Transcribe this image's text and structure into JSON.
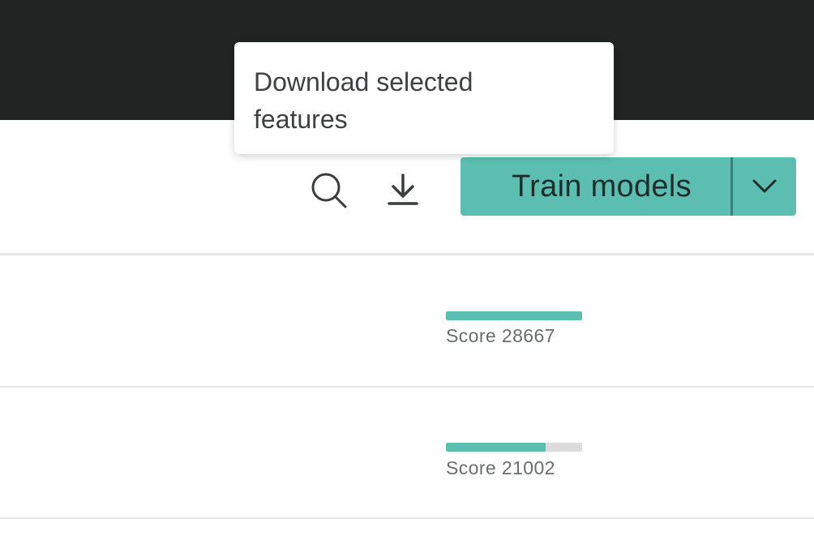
{
  "tooltip": {
    "text_line1": "Download selected",
    "text_line2": "features"
  },
  "toolbar": {
    "search_icon": "search-icon",
    "download_icon": "download-icon",
    "train_button_label": "Train models",
    "dropdown_icon": "chevron-down-icon",
    "accent_color": "#5bbeb0"
  },
  "rows": [
    {
      "score_label": "Score 28667",
      "score_fraction": 1.0
    },
    {
      "score_label": "Score 21002",
      "score_fraction": 0.73
    }
  ],
  "colors": {
    "topbar": "#222323",
    "score_fill": "#5bbeb0",
    "score_track": "#dcdcdc"
  }
}
